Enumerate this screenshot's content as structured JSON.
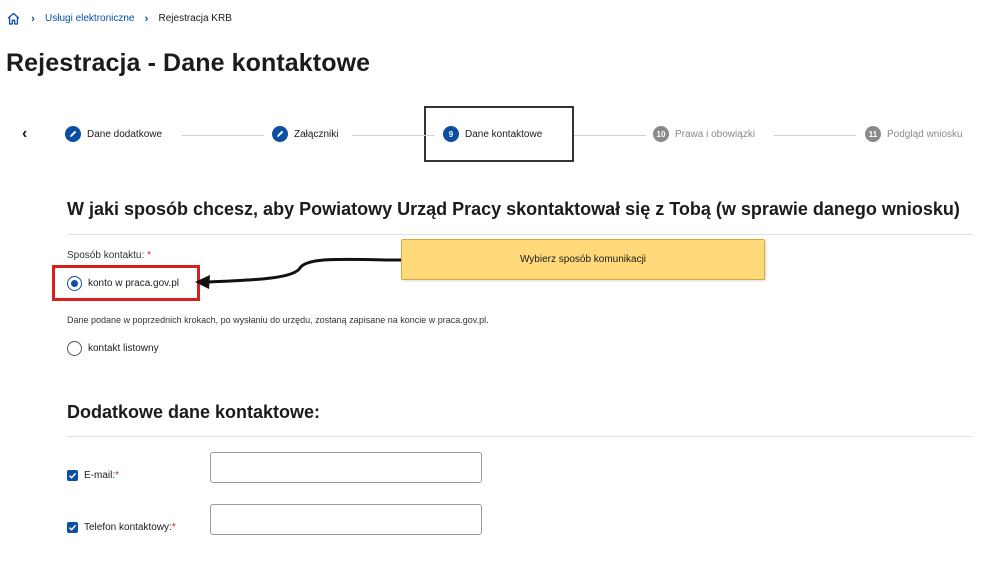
{
  "breadcrumb": {
    "home_icon": "home-icon",
    "items": [
      "Usługi elektroniczne",
      "Rejestracja KRB"
    ]
  },
  "page_title": "Rejestracja - Dane kontaktowe",
  "stepper": {
    "prev_icon": "chevron-left-icon",
    "steps": [
      {
        "number": "",
        "label": "Dane dodatkowe",
        "state": "done"
      },
      {
        "number": "",
        "label": "Załączniki",
        "state": "done"
      },
      {
        "number": "9",
        "label": "Dane kontaktowe",
        "state": "active"
      },
      {
        "number": "10",
        "label": "Prawa i obowiązki",
        "state": "todo"
      },
      {
        "number": "11",
        "label": "Podgląd wniosku",
        "state": "todo"
      }
    ]
  },
  "question": "W jaki sposób chcesz, aby Powiatowy Urząd Pracy skontaktował się z Tobą (w sprawie danego wniosku)",
  "contact_method": {
    "label": "Sposób kontaktu:",
    "required_mark": "*",
    "options": [
      {
        "label": "konto w praca.gov.pl",
        "checked": true
      },
      {
        "label": "kontakt listowny",
        "checked": false
      }
    ],
    "info": "Dane podane w poprzednich krokach, po wysłaniu do urzędu, zostaną zapisane na koncie w praca.gov.pl."
  },
  "callout": "Wybierz sposób komunikacji",
  "additional": {
    "title": "Dodatkowe dane kontaktowe:",
    "fields": [
      {
        "label": "E-mail:",
        "required_mark": "*",
        "checked": true,
        "value": ""
      },
      {
        "label": "Telefon kontaktowy:",
        "required_mark": "*",
        "checked": true,
        "value": ""
      }
    ]
  },
  "colors": {
    "accent": "#0b4ea2",
    "highlight": "#d62020",
    "callout_bg": "#ffd97a",
    "required": "#c1272d"
  }
}
